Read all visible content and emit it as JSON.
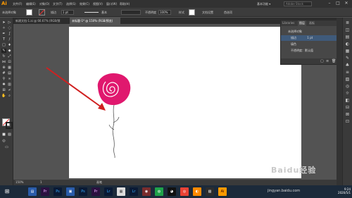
{
  "app": {
    "logo": "Ai"
  },
  "menu": {
    "items": [
      "文件(F)",
      "编辑(E)",
      "对象(O)",
      "文字(T)",
      "选择(S)",
      "效果(C)",
      "视图(V)",
      "窗口(W)",
      "帮助(H)"
    ],
    "right_label": "基本功能 ▾",
    "search_placeholder": "Adobe Stock"
  },
  "controlbar": {
    "label_left": "未选择对象",
    "stroke_label": "描边",
    "stroke_value": "1 pt",
    "brush_label": "基本",
    "opacity_label": "不透明度",
    "opacity_value": "100%",
    "style_label": "样式",
    "doc_setup": "文档设置",
    "prefs": "首选项"
  },
  "tabs": [
    {
      "label": "新建文档-1.ai @ 66.67% (RGB/预览)"
    },
    {
      "label": "未标题-1* @ 150% (RGB/预览)"
    }
  ],
  "layers_panel": {
    "tabs": [
      "Libraries",
      "图层",
      "画板"
    ],
    "rows": [
      {
        "label": "未选择对象"
      },
      {
        "label": "描边",
        "value": "1 pt"
      },
      {
        "label": "填色"
      },
      {
        "label": "不透明度：默认值"
      }
    ]
  },
  "statusbar": {
    "zoom": "150%",
    "page": "1",
    "tool": "画笔"
  },
  "watermark": {
    "text": "Baidu经验",
    "url": "jingyan.baidu.com"
  },
  "taskbar": {
    "time": "9:24",
    "date": "2020/5/1"
  },
  "colors": {
    "rose": "#e0186e",
    "arrow": "#d02020",
    "accent": "#ff9a00"
  }
}
